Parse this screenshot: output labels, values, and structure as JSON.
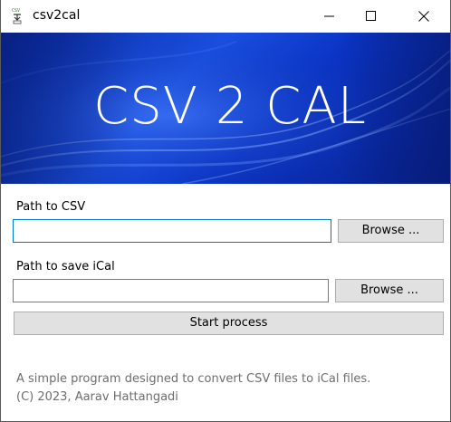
{
  "window": {
    "title": "csv2cal",
    "icon": "csv2cal-app-icon",
    "controls": {
      "minimize_icon": "minimize-icon",
      "maximize_icon": "maximize-icon",
      "close_icon": "close-icon"
    }
  },
  "banner": {
    "title": "CSV 2 CAL",
    "colors": {
      "dark": "#08208a",
      "mid": "#1a4fe0",
      "highlight": "#6fa0ff"
    }
  },
  "form": {
    "csv": {
      "label": "Path to CSV",
      "value": "",
      "browse_label": "Browse ..."
    },
    "ical": {
      "label": "Path to save iCal",
      "value": "",
      "browse_label": "Browse ..."
    },
    "start_label": "Start process"
  },
  "footer": {
    "description": "A simple program designed to convert CSV files to iCal files.",
    "copyright": "(C) 2023, Aarav Hattangadi"
  },
  "colors": {
    "accent": "#0078d7",
    "button_bg": "#e1e1e1",
    "button_border": "#adadad",
    "footer_text": "#6d6d6d"
  }
}
